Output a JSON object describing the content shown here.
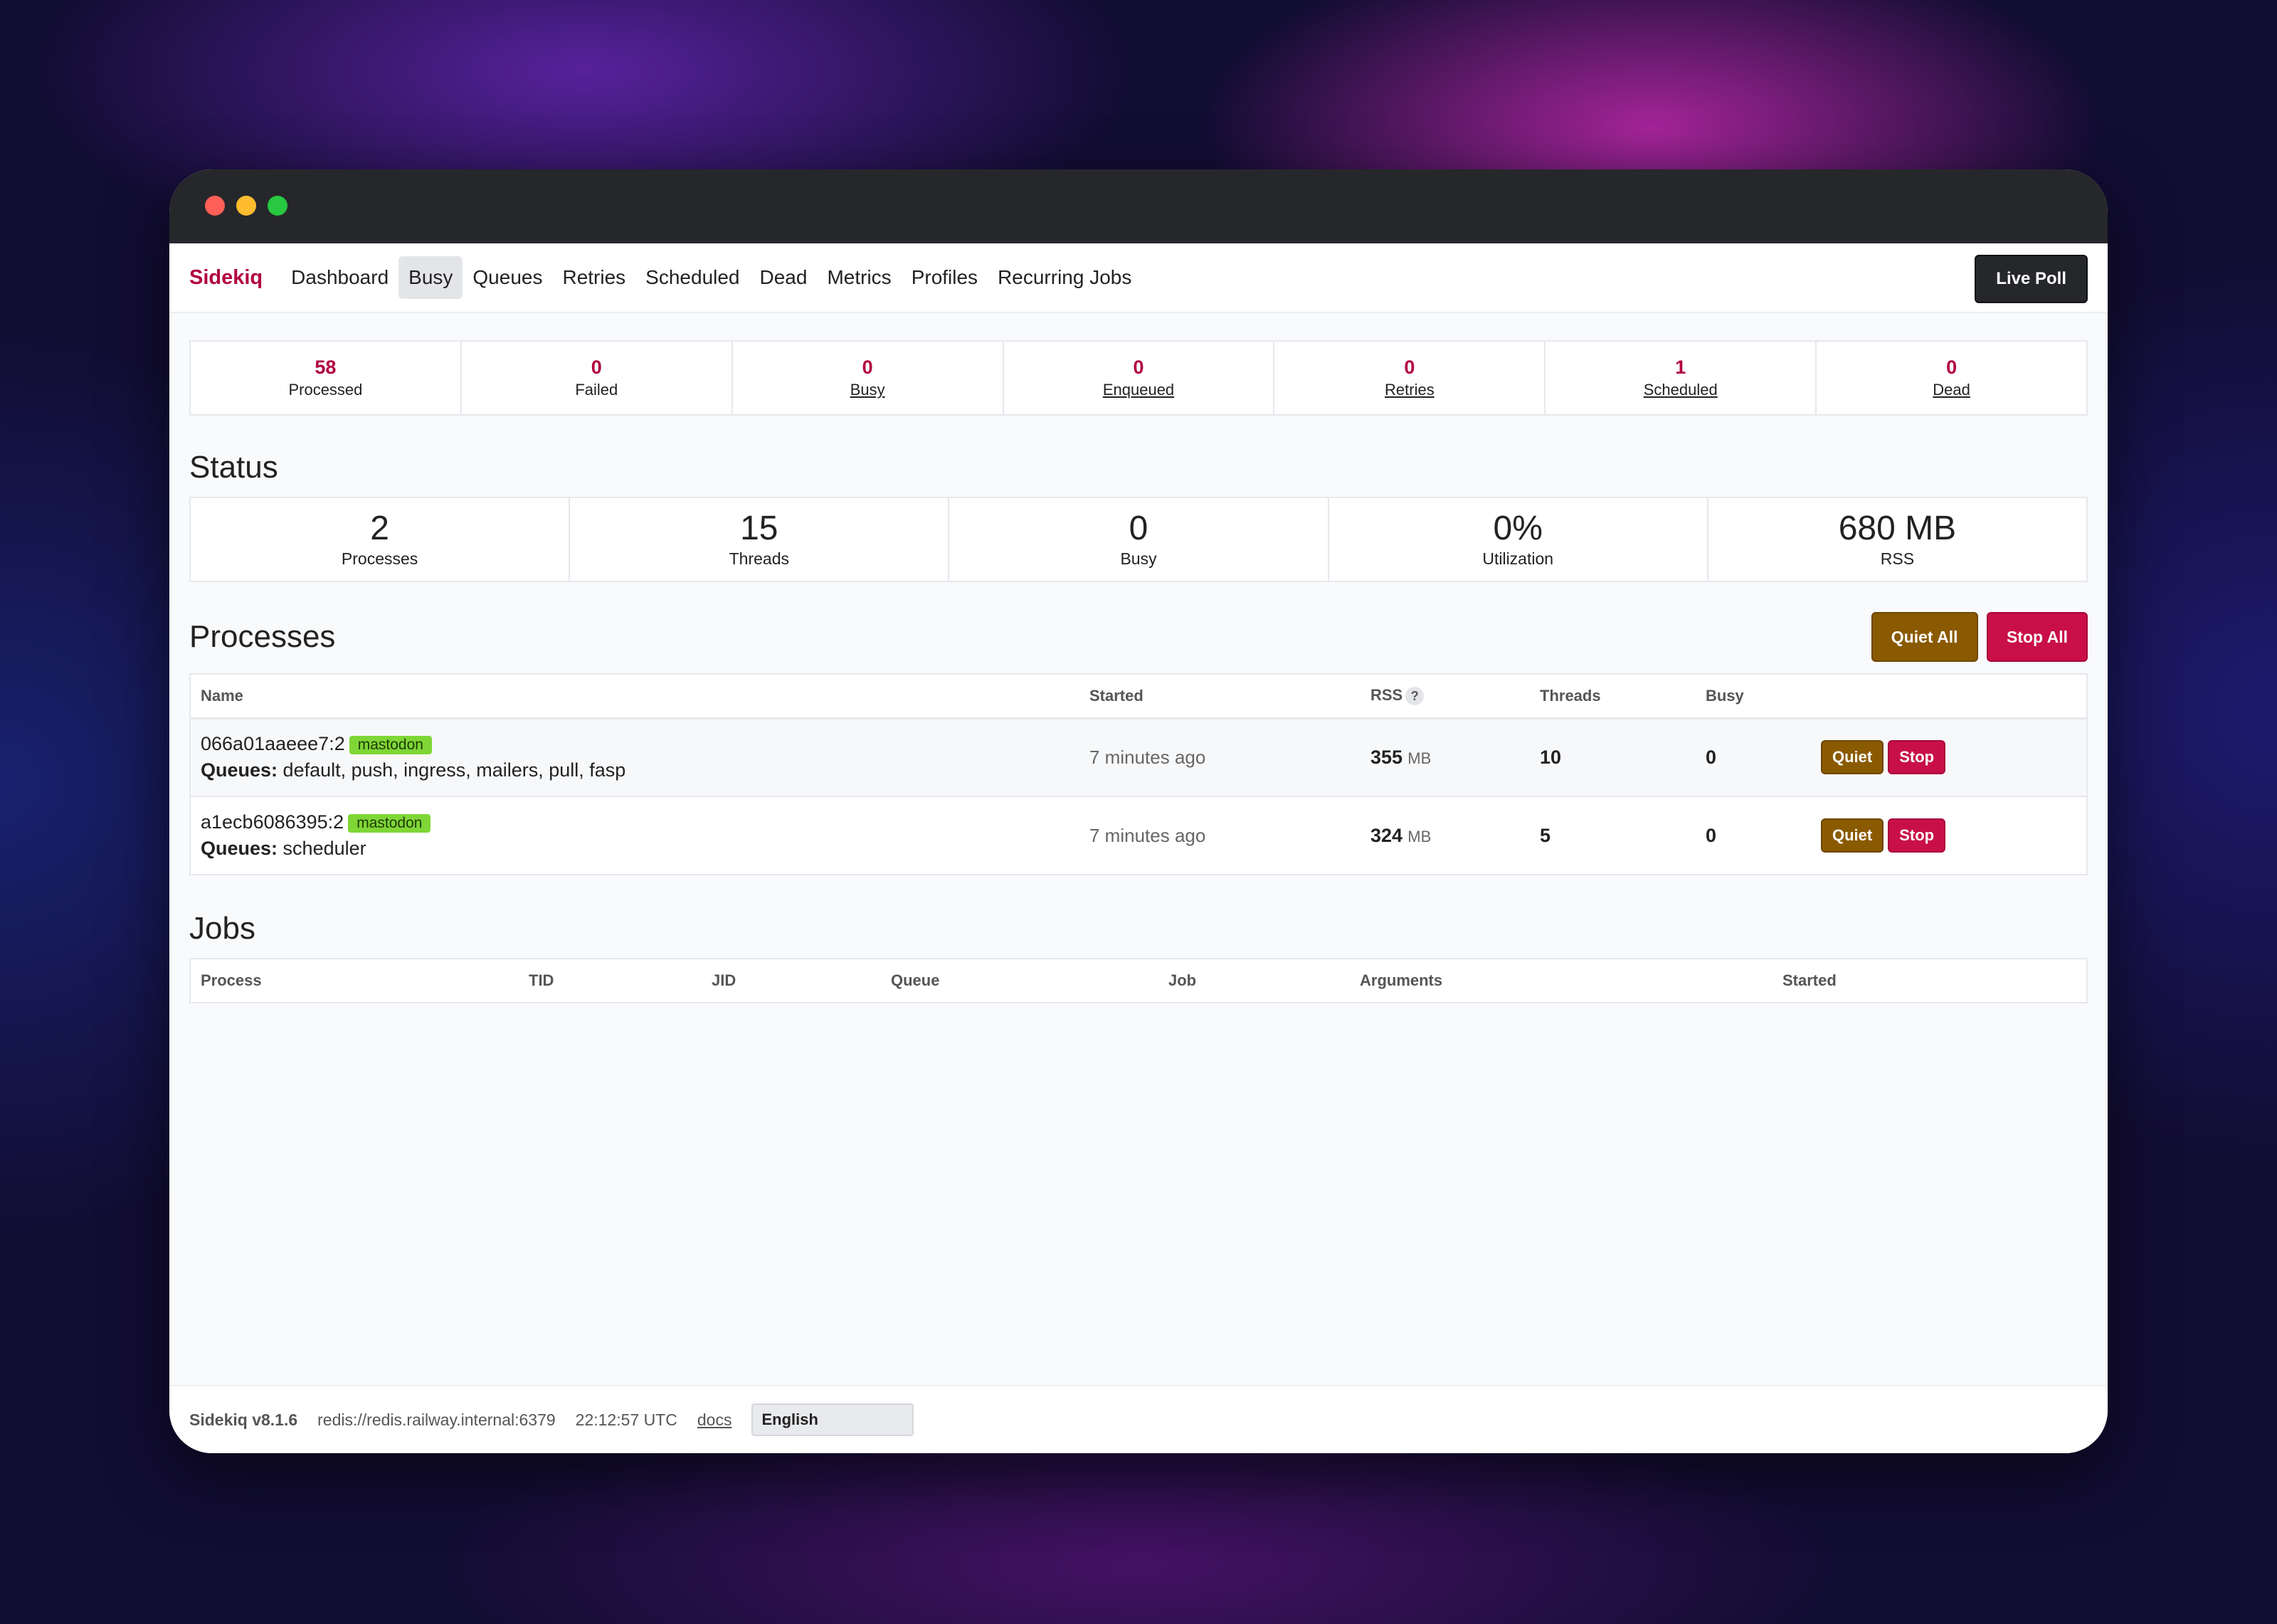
{
  "brand": "Sidekiq",
  "nav": {
    "items": [
      "Dashboard",
      "Busy",
      "Queues",
      "Retries",
      "Scheduled",
      "Dead",
      "Metrics",
      "Profiles",
      "Recurring Jobs"
    ],
    "active": "Busy",
    "live_poll": "Live Poll"
  },
  "stats": [
    {
      "value": "58",
      "label": "Processed"
    },
    {
      "value": "0",
      "label": "Failed"
    },
    {
      "value": "0",
      "label": "Busy"
    },
    {
      "value": "0",
      "label": "Enqueued"
    },
    {
      "value": "0",
      "label": "Retries"
    },
    {
      "value": "1",
      "label": "Scheduled"
    },
    {
      "value": "0",
      "label": "Dead"
    }
  ],
  "status": {
    "title": "Status",
    "items": [
      {
        "value": "2",
        "label": "Processes"
      },
      {
        "value": "15",
        "label": "Threads"
      },
      {
        "value": "0",
        "label": "Busy"
      },
      {
        "value": "0%",
        "label": "Utilization"
      },
      {
        "value": "680 MB",
        "label": "RSS"
      }
    ]
  },
  "processes": {
    "title": "Processes",
    "quiet_all": "Quiet All",
    "stop_all": "Stop All",
    "columns": {
      "name": "Name",
      "started": "Started",
      "rss": "RSS",
      "rss_help": "?",
      "threads": "Threads",
      "busy": "Busy"
    },
    "rows": [
      {
        "name": "066a01aaeee7:2",
        "tag": "mastodon",
        "queues_label": "Queues:",
        "queues": "default, push, ingress, mailers, pull, fasp",
        "started": "7 minutes ago",
        "rss": "355",
        "rss_unit": "MB",
        "threads": "10",
        "busy": "0",
        "quiet": "Quiet",
        "stop": "Stop"
      },
      {
        "name": "a1ecb6086395:2",
        "tag": "mastodon",
        "queues_label": "Queues:",
        "queues": "scheduler",
        "started": "7 minutes ago",
        "rss": "324",
        "rss_unit": "MB",
        "threads": "5",
        "busy": "0",
        "quiet": "Quiet",
        "stop": "Stop"
      }
    ]
  },
  "jobs": {
    "title": "Jobs",
    "columns": [
      "Process",
      "TID",
      "JID",
      "Queue",
      "Job",
      "Arguments",
      "Started"
    ]
  },
  "footer": {
    "version": "Sidekiq v8.1.6",
    "redis": "redis://redis.railway.internal:6379",
    "time": "22:12:57 UTC",
    "docs": "docs",
    "language": "English"
  },
  "colors": {
    "brand": "#b1003e",
    "quiet": "#8a5a00",
    "stop": "#c90f48",
    "tag": "#7fd636"
  }
}
